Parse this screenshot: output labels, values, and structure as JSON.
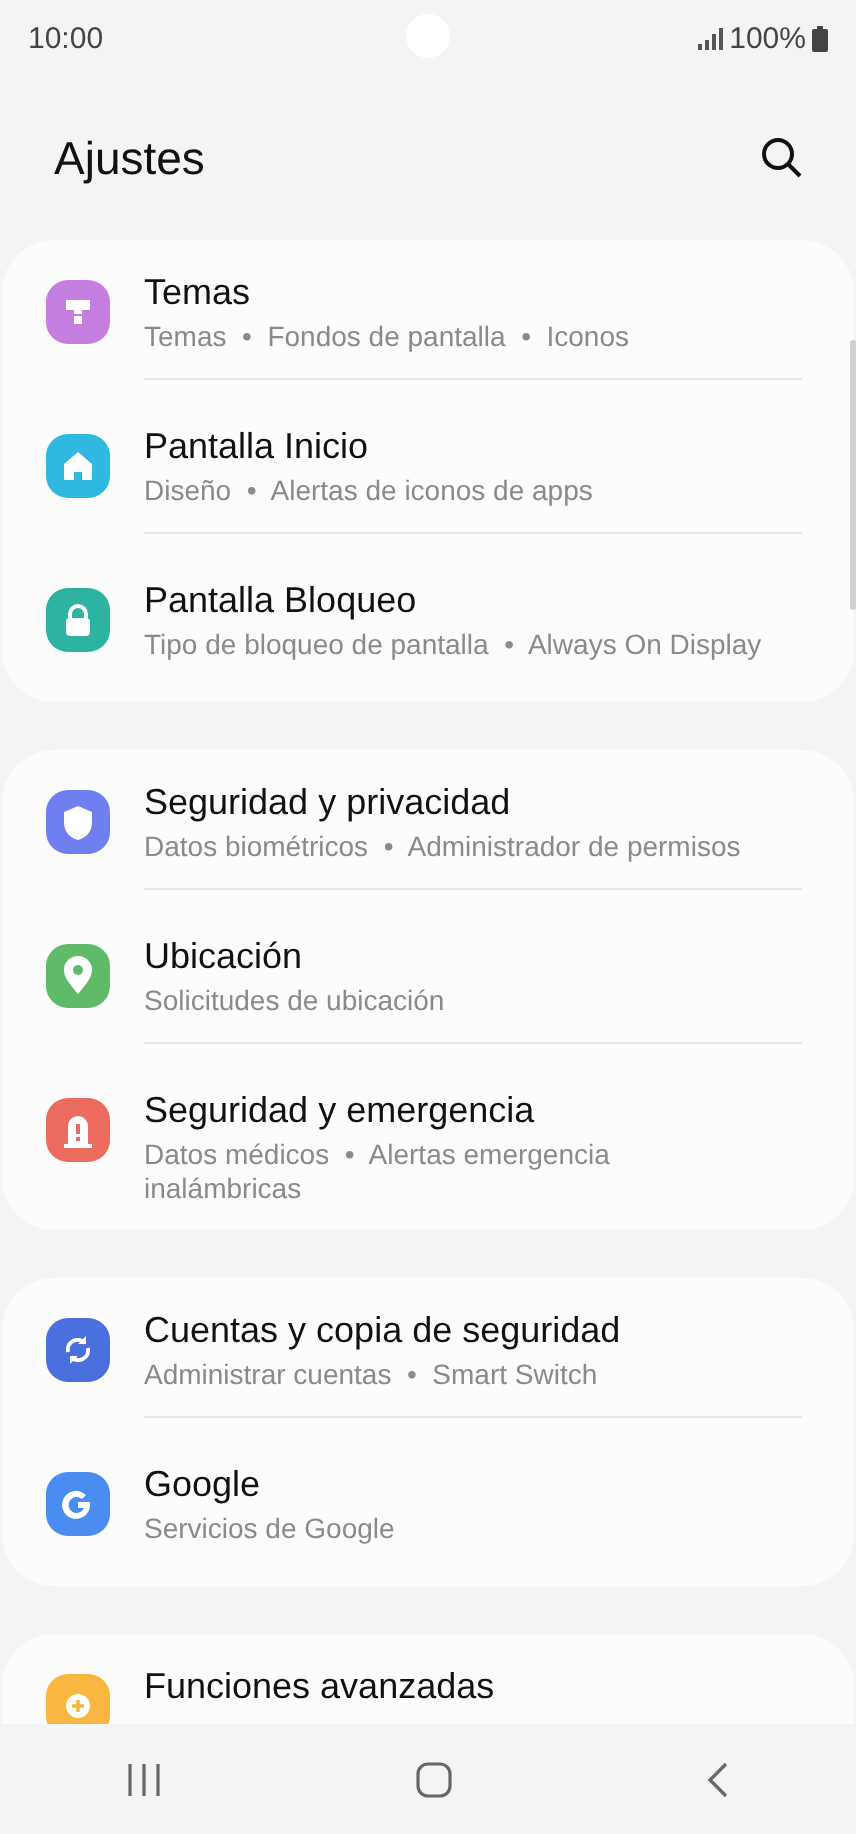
{
  "status_bar": {
    "time": "10:00",
    "battery": "100%"
  },
  "header": {
    "title": "Ajustes"
  },
  "groups": [
    {
      "items": [
        {
          "title": "Temas",
          "subtitle": "Temas  •  Fondos de pantalla  •  Iconos",
          "color": "#c47ee0"
        },
        {
          "title": "Pantalla Inicio",
          "subtitle": "Diseño  •  Alertas de iconos de apps",
          "color": "#2fb9e0"
        },
        {
          "title": "Pantalla Bloqueo",
          "subtitle": "Tipo de bloqueo de pantalla  •  Always On Display",
          "color": "#2db3a0"
        }
      ]
    },
    {
      "items": [
        {
          "title": "Seguridad y privacidad",
          "subtitle": "Datos biométricos  •  Administrador de permisos",
          "color": "#6f7ff0"
        },
        {
          "title": "Ubicación",
          "subtitle": "Solicitudes de ubicación",
          "color": "#5fbb6a"
        },
        {
          "title": "Seguridad y emergencia",
          "subtitle": "Datos médicos  •  Alertas emergencia\ninalámbricas",
          "color": "#eb6b5e"
        }
      ]
    },
    {
      "items": [
        {
          "title": "Cuentas y copia de seguridad",
          "subtitle": "Administrar cuentas  •  Smart Switch",
          "color": "#4b6fdc"
        },
        {
          "title": "Google",
          "subtitle": "Servicios de Google",
          "color": "#4a8cf0"
        }
      ]
    },
    {
      "items": [
        {
          "title": "Funciones avanzadas",
          "color": "#f9b640"
        }
      ]
    }
  ]
}
